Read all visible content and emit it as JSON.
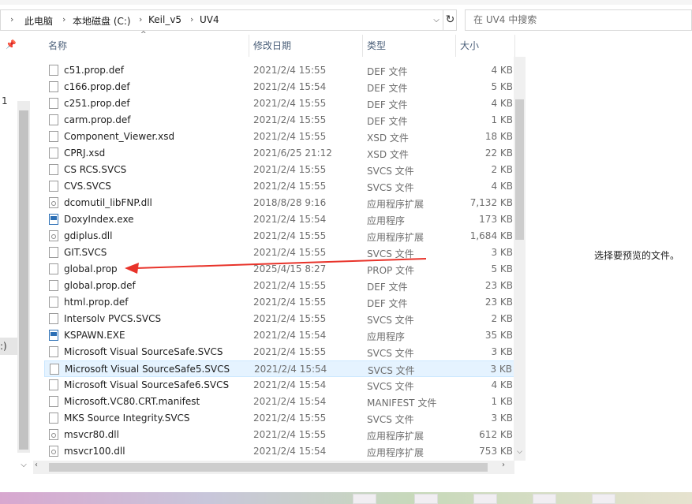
{
  "breadcrumb": {
    "items": [
      "此电脑",
      "本地磁盘 (C:)",
      "Keil_v5",
      "UV4"
    ],
    "separator": "›"
  },
  "search": {
    "placeholder": "在 UV4 中搜索"
  },
  "nav": {
    "label_1": "1",
    "label_2": ":)"
  },
  "columns": {
    "name": "名称",
    "date": "修改日期",
    "type": "类型",
    "size": "大小"
  },
  "files": [
    {
      "name": "c51.prop.def",
      "date": "2021/2/4 15:55",
      "type": "DEF 文件",
      "size": "4 KB",
      "icon": "file-icon"
    },
    {
      "name": "c166.prop.def",
      "date": "2021/2/4 15:54",
      "type": "DEF 文件",
      "size": "5 KB",
      "icon": "file-icon"
    },
    {
      "name": "c251.prop.def",
      "date": "2021/2/4 15:55",
      "type": "DEF 文件",
      "size": "4 KB",
      "icon": "file-icon"
    },
    {
      "name": "carm.prop.def",
      "date": "2021/2/4 15:55",
      "type": "DEF 文件",
      "size": "1 KB",
      "icon": "file-icon"
    },
    {
      "name": "Component_Viewer.xsd",
      "date": "2021/2/4 15:55",
      "type": "XSD 文件",
      "size": "18 KB",
      "icon": "file-icon"
    },
    {
      "name": "CPRJ.xsd",
      "date": "2021/6/25 21:12",
      "type": "XSD 文件",
      "size": "22 KB",
      "icon": "file-icon"
    },
    {
      "name": "CS RCS.SVCS",
      "date": "2021/2/4 15:55",
      "type": "SVCS 文件",
      "size": "2 KB",
      "icon": "file-icon"
    },
    {
      "name": "CVS.SVCS",
      "date": "2021/2/4 15:55",
      "type": "SVCS 文件",
      "size": "4 KB",
      "icon": "file-icon"
    },
    {
      "name": "dcomutil_libFNP.dll",
      "date": "2018/8/28 9:16",
      "type": "应用程序扩展",
      "size": "7,132 KB",
      "icon": "dll-icon"
    },
    {
      "name": "DoxyIndex.exe",
      "date": "2021/2/4 15:54",
      "type": "应用程序",
      "size": "173 KB",
      "icon": "exe-icon"
    },
    {
      "name": "gdiplus.dll",
      "date": "2021/2/4 15:55",
      "type": "应用程序扩展",
      "size": "1,684 KB",
      "icon": "dll-icon"
    },
    {
      "name": "GIT.SVCS",
      "date": "2021/2/4 15:55",
      "type": "SVCS 文件",
      "size": "3 KB",
      "icon": "file-icon"
    },
    {
      "name": "global.prop",
      "date": "2025/4/15 8:27",
      "type": "PROP 文件",
      "size": "5 KB",
      "icon": "file-icon"
    },
    {
      "name": "global.prop.def",
      "date": "2021/2/4 15:55",
      "type": "DEF 文件",
      "size": "23 KB",
      "icon": "file-icon"
    },
    {
      "name": "html.prop.def",
      "date": "2021/2/4 15:55",
      "type": "DEF 文件",
      "size": "23 KB",
      "icon": "file-icon"
    },
    {
      "name": "Intersolv PVCS.SVCS",
      "date": "2021/2/4 15:55",
      "type": "SVCS 文件",
      "size": "2 KB",
      "icon": "file-icon"
    },
    {
      "name": "KSPAWN.EXE",
      "date": "2021/2/4 15:54",
      "type": "应用程序",
      "size": "35 KB",
      "icon": "exe-icon"
    },
    {
      "name": "Microsoft Visual SourceSafe.SVCS",
      "date": "2021/2/4 15:55",
      "type": "SVCS 文件",
      "size": "3 KB",
      "icon": "file-icon"
    },
    {
      "name": "Microsoft Visual SourceSafe5.SVCS",
      "date": "2021/2/4 15:54",
      "type": "SVCS 文件",
      "size": "3 KB",
      "icon": "file-icon",
      "selected": true
    },
    {
      "name": "Microsoft Visual SourceSafe6.SVCS",
      "date": "2021/2/4 15:54",
      "type": "SVCS 文件",
      "size": "4 KB",
      "icon": "file-icon"
    },
    {
      "name": "Microsoft.VC80.CRT.manifest",
      "date": "2021/2/4 15:54",
      "type": "MANIFEST 文件",
      "size": "1 KB",
      "icon": "file-icon"
    },
    {
      "name": "MKS Source Integrity.SVCS",
      "date": "2021/2/4 15:55",
      "type": "SVCS 文件",
      "size": "3 KB",
      "icon": "file-icon"
    },
    {
      "name": "msvcr80.dll",
      "date": "2021/2/4 15:55",
      "type": "应用程序扩展",
      "size": "612 KB",
      "icon": "dll-icon"
    },
    {
      "name": "msvcr100.dll",
      "date": "2021/2/4 15:54",
      "type": "应用程序扩展",
      "size": "753 KB",
      "icon": "dll-icon"
    }
  ],
  "preview": {
    "text": "选择要预览的文件。"
  },
  "colors": {
    "selected_row": "#e5f3ff",
    "annotation_arrow": "#e8332a",
    "header_text": "#4c607a"
  }
}
